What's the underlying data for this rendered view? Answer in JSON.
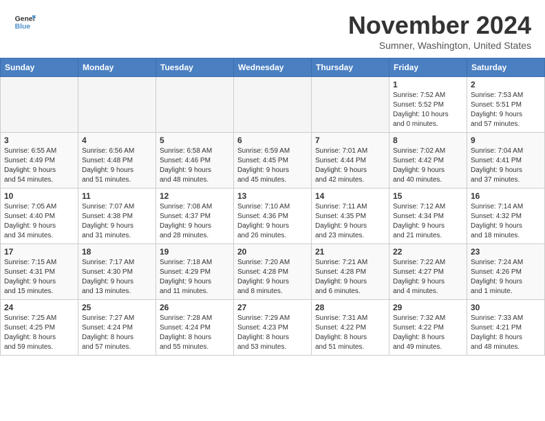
{
  "header": {
    "logo_line1": "General",
    "logo_line2": "Blue",
    "month": "November 2024",
    "location": "Sumner, Washington, United States"
  },
  "days_of_week": [
    "Sunday",
    "Monday",
    "Tuesday",
    "Wednesday",
    "Thursday",
    "Friday",
    "Saturday"
  ],
  "weeks": [
    [
      {
        "day": "",
        "info": ""
      },
      {
        "day": "",
        "info": ""
      },
      {
        "day": "",
        "info": ""
      },
      {
        "day": "",
        "info": ""
      },
      {
        "day": "",
        "info": ""
      },
      {
        "day": "1",
        "info": "Sunrise: 7:52 AM\nSunset: 5:52 PM\nDaylight: 10 hours\nand 0 minutes."
      },
      {
        "day": "2",
        "info": "Sunrise: 7:53 AM\nSunset: 5:51 PM\nDaylight: 9 hours\nand 57 minutes."
      }
    ],
    [
      {
        "day": "3",
        "info": "Sunrise: 6:55 AM\nSunset: 4:49 PM\nDaylight: 9 hours\nand 54 minutes."
      },
      {
        "day": "4",
        "info": "Sunrise: 6:56 AM\nSunset: 4:48 PM\nDaylight: 9 hours\nand 51 minutes."
      },
      {
        "day": "5",
        "info": "Sunrise: 6:58 AM\nSunset: 4:46 PM\nDaylight: 9 hours\nand 48 minutes."
      },
      {
        "day": "6",
        "info": "Sunrise: 6:59 AM\nSunset: 4:45 PM\nDaylight: 9 hours\nand 45 minutes."
      },
      {
        "day": "7",
        "info": "Sunrise: 7:01 AM\nSunset: 4:44 PM\nDaylight: 9 hours\nand 42 minutes."
      },
      {
        "day": "8",
        "info": "Sunrise: 7:02 AM\nSunset: 4:42 PM\nDaylight: 9 hours\nand 40 minutes."
      },
      {
        "day": "9",
        "info": "Sunrise: 7:04 AM\nSunset: 4:41 PM\nDaylight: 9 hours\nand 37 minutes."
      }
    ],
    [
      {
        "day": "10",
        "info": "Sunrise: 7:05 AM\nSunset: 4:40 PM\nDaylight: 9 hours\nand 34 minutes."
      },
      {
        "day": "11",
        "info": "Sunrise: 7:07 AM\nSunset: 4:38 PM\nDaylight: 9 hours\nand 31 minutes."
      },
      {
        "day": "12",
        "info": "Sunrise: 7:08 AM\nSunset: 4:37 PM\nDaylight: 9 hours\nand 28 minutes."
      },
      {
        "day": "13",
        "info": "Sunrise: 7:10 AM\nSunset: 4:36 PM\nDaylight: 9 hours\nand 26 minutes."
      },
      {
        "day": "14",
        "info": "Sunrise: 7:11 AM\nSunset: 4:35 PM\nDaylight: 9 hours\nand 23 minutes."
      },
      {
        "day": "15",
        "info": "Sunrise: 7:12 AM\nSunset: 4:34 PM\nDaylight: 9 hours\nand 21 minutes."
      },
      {
        "day": "16",
        "info": "Sunrise: 7:14 AM\nSunset: 4:32 PM\nDaylight: 9 hours\nand 18 minutes."
      }
    ],
    [
      {
        "day": "17",
        "info": "Sunrise: 7:15 AM\nSunset: 4:31 PM\nDaylight: 9 hours\nand 15 minutes."
      },
      {
        "day": "18",
        "info": "Sunrise: 7:17 AM\nSunset: 4:30 PM\nDaylight: 9 hours\nand 13 minutes."
      },
      {
        "day": "19",
        "info": "Sunrise: 7:18 AM\nSunset: 4:29 PM\nDaylight: 9 hours\nand 11 minutes."
      },
      {
        "day": "20",
        "info": "Sunrise: 7:20 AM\nSunset: 4:28 PM\nDaylight: 9 hours\nand 8 minutes."
      },
      {
        "day": "21",
        "info": "Sunrise: 7:21 AM\nSunset: 4:28 PM\nDaylight: 9 hours\nand 6 minutes."
      },
      {
        "day": "22",
        "info": "Sunrise: 7:22 AM\nSunset: 4:27 PM\nDaylight: 9 hours\nand 4 minutes."
      },
      {
        "day": "23",
        "info": "Sunrise: 7:24 AM\nSunset: 4:26 PM\nDaylight: 9 hours\nand 1 minute."
      }
    ],
    [
      {
        "day": "24",
        "info": "Sunrise: 7:25 AM\nSunset: 4:25 PM\nDaylight: 8 hours\nand 59 minutes."
      },
      {
        "day": "25",
        "info": "Sunrise: 7:27 AM\nSunset: 4:24 PM\nDaylight: 8 hours\nand 57 minutes."
      },
      {
        "day": "26",
        "info": "Sunrise: 7:28 AM\nSunset: 4:24 PM\nDaylight: 8 hours\nand 55 minutes."
      },
      {
        "day": "27",
        "info": "Sunrise: 7:29 AM\nSunset: 4:23 PM\nDaylight: 8 hours\nand 53 minutes."
      },
      {
        "day": "28",
        "info": "Sunrise: 7:31 AM\nSunset: 4:22 PM\nDaylight: 8 hours\nand 51 minutes."
      },
      {
        "day": "29",
        "info": "Sunrise: 7:32 AM\nSunset: 4:22 PM\nDaylight: 8 hours\nand 49 minutes."
      },
      {
        "day": "30",
        "info": "Sunrise: 7:33 AM\nSunset: 4:21 PM\nDaylight: 8 hours\nand 48 minutes."
      }
    ]
  ]
}
